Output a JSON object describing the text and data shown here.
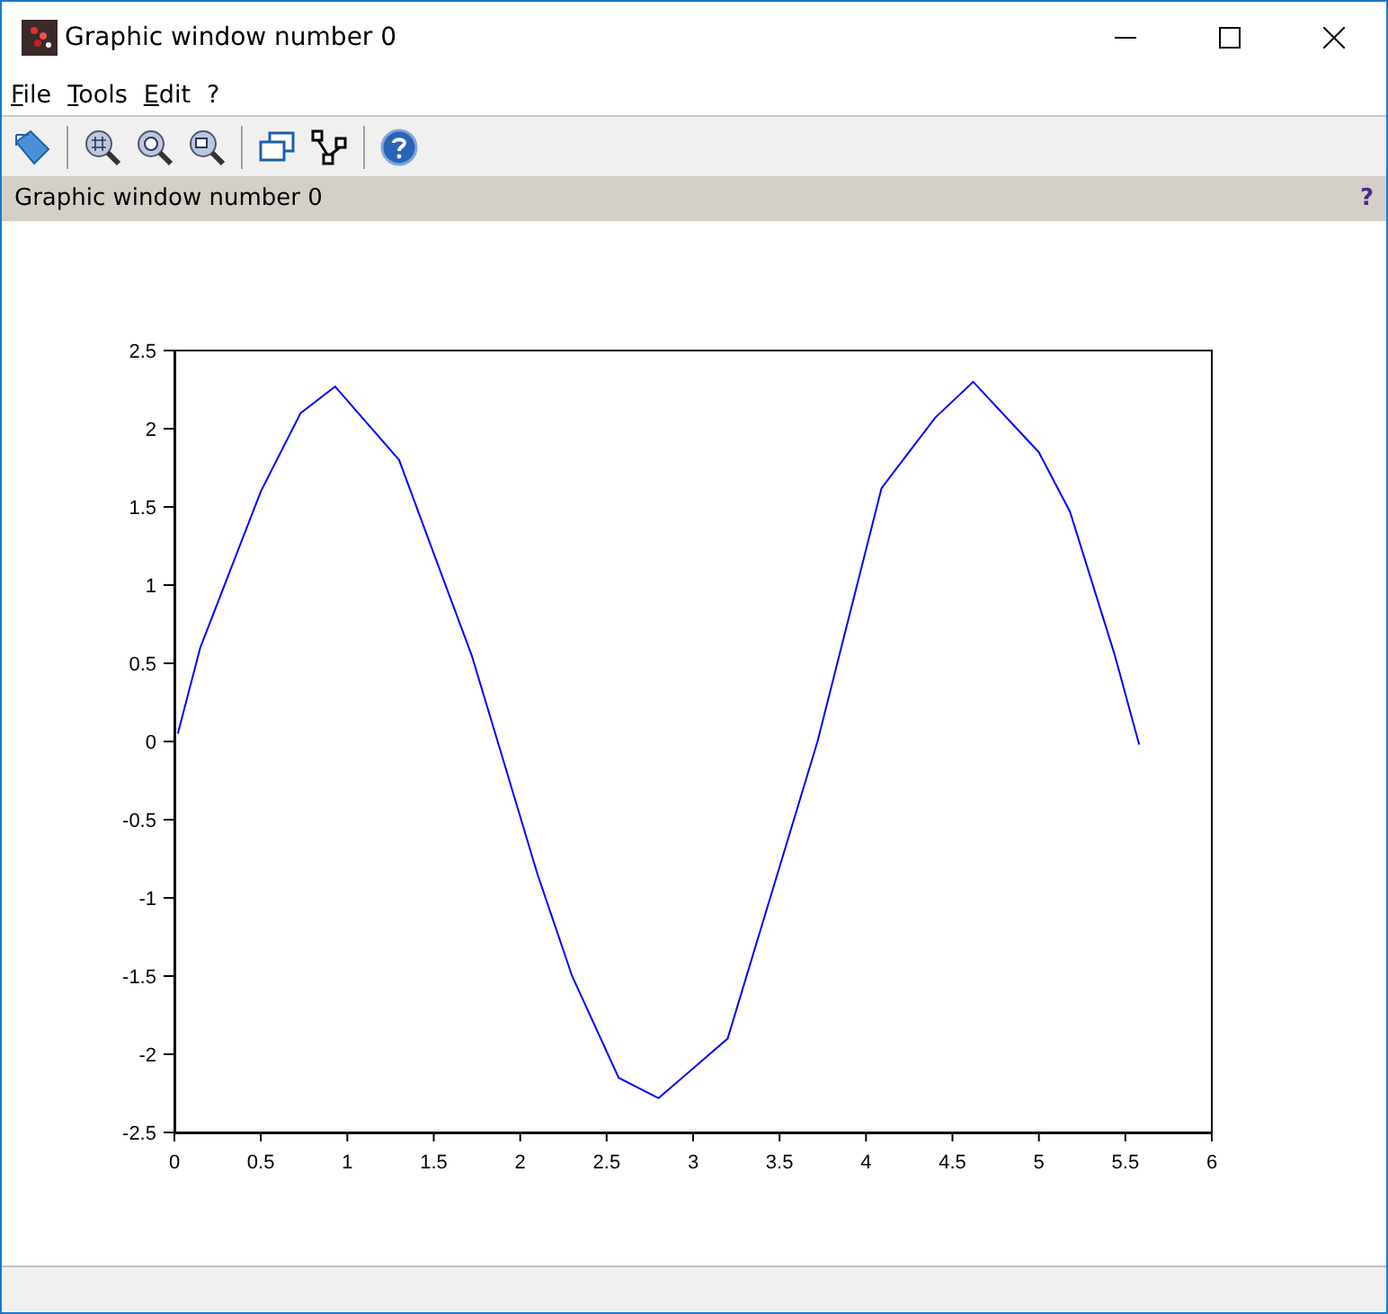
{
  "window": {
    "title": "Graphic window number 0"
  },
  "menu": [
    {
      "label": "File"
    },
    {
      "label": "Tools"
    },
    {
      "label": "Edit"
    },
    {
      "label": "?"
    }
  ],
  "header": {
    "title": "Graphic window number 0",
    "help": "?"
  },
  "chart_data": {
    "type": "line",
    "x": [
      0.02,
      0.15,
      0.5,
      0.73,
      0.93,
      1.3,
      1.5,
      1.72,
      1.87,
      2.1,
      2.3,
      2.57,
      2.8,
      3.2,
      3.72,
      4.09,
      4.4,
      4.62,
      5.0,
      5.18,
      5.44,
      5.58
    ],
    "series": [
      {
        "color": "#0000ff",
        "values": [
          0.05,
          0.6,
          1.6,
          2.1,
          2.27,
          1.8,
          1.2,
          0.55,
          0.0,
          -0.85,
          -1.5,
          -2.15,
          -2.28,
          -1.9,
          0.0,
          1.62,
          2.07,
          2.3,
          1.85,
          1.47,
          0.55,
          -0.02
        ]
      }
    ],
    "xlim": [
      0,
      6
    ],
    "ylim": [
      -2.5,
      2.5
    ],
    "xticks": [
      {
        "value": 0,
        "label": "0"
      },
      {
        "value": 0.5,
        "label": "0.5"
      },
      {
        "value": 1,
        "label": "1"
      },
      {
        "value": 1.5,
        "label": "1.5"
      },
      {
        "value": 2,
        "label": "2"
      },
      {
        "value": 2.5,
        "label": "2.5"
      },
      {
        "value": 3,
        "label": "3"
      },
      {
        "value": 3.5,
        "label": "3.5"
      },
      {
        "value": 4,
        "label": "4"
      },
      {
        "value": 4.5,
        "label": "4.5"
      },
      {
        "value": 5,
        "label": "5"
      },
      {
        "value": 5.5,
        "label": "5.5"
      },
      {
        "value": 6,
        "label": "6"
      }
    ],
    "yticks": [
      {
        "value": 2.5,
        "label": "2.5"
      },
      {
        "value": 2,
        "label": "2"
      },
      {
        "value": 1.5,
        "label": "1.5"
      },
      {
        "value": 1,
        "label": "1"
      },
      {
        "value": 0.5,
        "label": "0.5"
      },
      {
        "value": 0,
        "label": "0"
      },
      {
        "value": -0.5,
        "label": "-0.5"
      },
      {
        "value": -1,
        "label": "-1"
      },
      {
        "value": -1.5,
        "label": "-1.5"
      },
      {
        "value": -2,
        "label": "-2"
      },
      {
        "value": -2.5,
        "label": "-2.5"
      }
    ]
  }
}
